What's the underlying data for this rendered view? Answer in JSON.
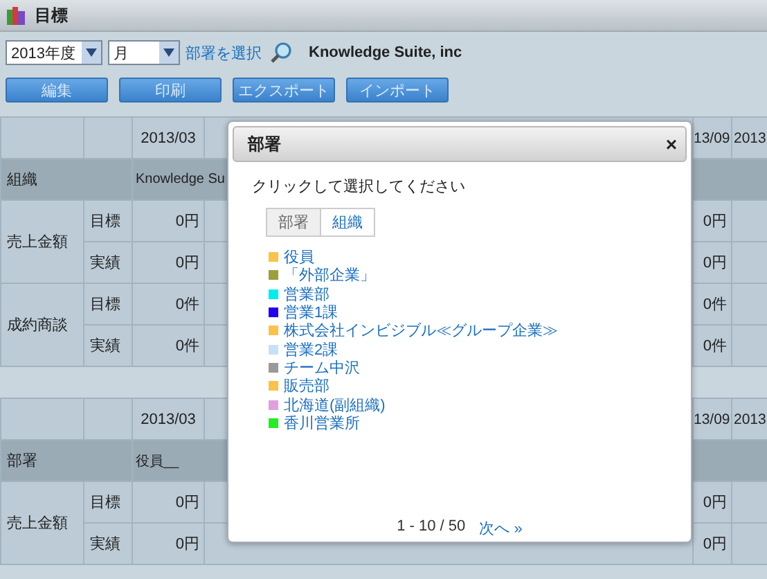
{
  "window": {
    "title": "目標"
  },
  "toolbar": {
    "year_select": "2013年度",
    "period_select": "月",
    "select_link": "部署を選択",
    "company": "Knowledge Suite, inc"
  },
  "buttons": [
    "編集",
    "印刷",
    "エクスポート",
    "インポート"
  ],
  "tables": [
    {
      "columns": [
        "2013/03",
        "13/09",
        "2013"
      ],
      "group": {
        "label": "組織",
        "value": "Knowledge Su"
      },
      "metrics": [
        {
          "name": "売上金額",
          "rows": [
            {
              "label": "目標",
              "first": "0円",
              "last": "0円"
            },
            {
              "label": "実績",
              "first": "0円",
              "last": "0円"
            }
          ]
        },
        {
          "name": "成約商談",
          "rows": [
            {
              "label": "目標",
              "first": "0件",
              "last": "0件"
            },
            {
              "label": "実績",
              "first": "0件",
              "last": "0件"
            }
          ]
        }
      ]
    },
    {
      "columns": [
        "2013/03",
        "13/09",
        "2013"
      ],
      "group": {
        "label": "部署",
        "value": "役員__"
      },
      "metrics": [
        {
          "name": "売上金額",
          "rows": [
            {
              "label": "目標",
              "first": "0円",
              "last": "0円"
            },
            {
              "label": "実績",
              "first": "0円",
              "last": "0円"
            }
          ]
        }
      ]
    }
  ],
  "dialog": {
    "title": "部署",
    "close": "×",
    "instruction": "クリックして選択してください",
    "tabs": [
      {
        "label": "部署",
        "selected": true
      },
      {
        "label": "組織",
        "selected": false
      }
    ],
    "items": [
      {
        "label": "役員",
        "color": "#f9c34a"
      },
      {
        "label": "「外部企業」",
        "color": "#9c9e40"
      },
      {
        "label": "営業部",
        "color": "#00eeee"
      },
      {
        "label": "営業1課",
        "color": "#2200ee"
      },
      {
        "label": "株式会社インビジブル≪グループ企業≫",
        "color": "#f9c34a"
      },
      {
        "label": "営業2課",
        "color": "#c8e0f8"
      },
      {
        "label": "チーム中沢",
        "color": "#999999"
      },
      {
        "label": "販売部",
        "color": "#f9c34a"
      },
      {
        "label": "北海道(副組織)",
        "color": "#e0a0e0"
      },
      {
        "label": "香川営業所",
        "color": "#22ee22"
      }
    ],
    "pagination": {
      "range": "1 - 10 / 50",
      "next": "次へ »"
    }
  }
}
